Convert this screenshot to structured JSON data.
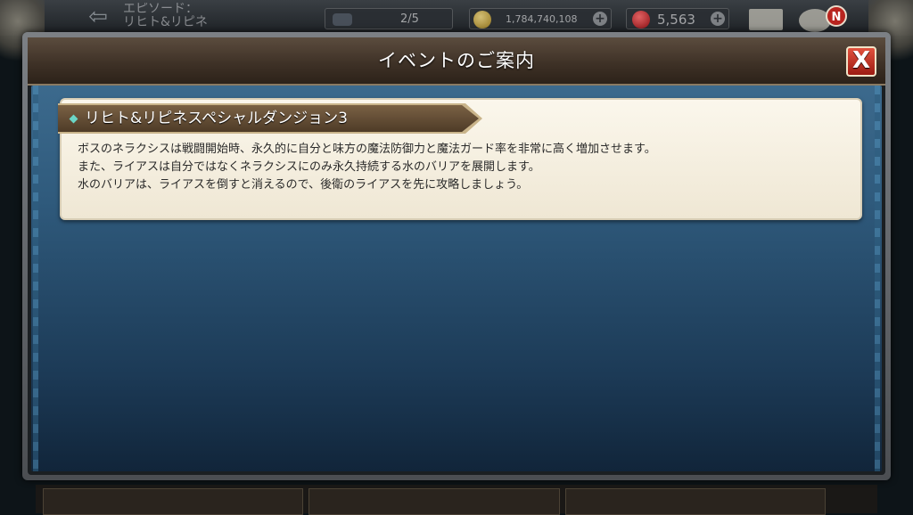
{
  "topbar": {
    "back_label": "⇦",
    "episode_title_line1": "エピソード：",
    "episode_title_line2": "リヒト&リピネ",
    "stamina": "2/5",
    "gold": "1,784,740,108",
    "gems": "5,563",
    "plus_symbol": "+",
    "notif_badge": "N"
  },
  "modal": {
    "title": "イベントのご案内",
    "close_label": "X",
    "event": {
      "title": "リヒト&リピネスペシャルダンジョン3",
      "lines": [
        "ボスのネラクシスは戦闘開始時、永久的に自分と味方の魔法防御力と魔法ガード率を非常に高く増加させます。",
        "また、ライアスは自分ではなくネラクシスにのみ永久持続する水のバリアを展開します。",
        "水のバリアは、ライアスを倒すと消えるので、後衛のライアスを先に攻略しましょう。"
      ]
    }
  },
  "colors": {
    "header_brown": "#3f3227",
    "body_blue": "#2f5a7c",
    "close_red": "#c0392b",
    "card_cream": "#f6f0e2"
  }
}
